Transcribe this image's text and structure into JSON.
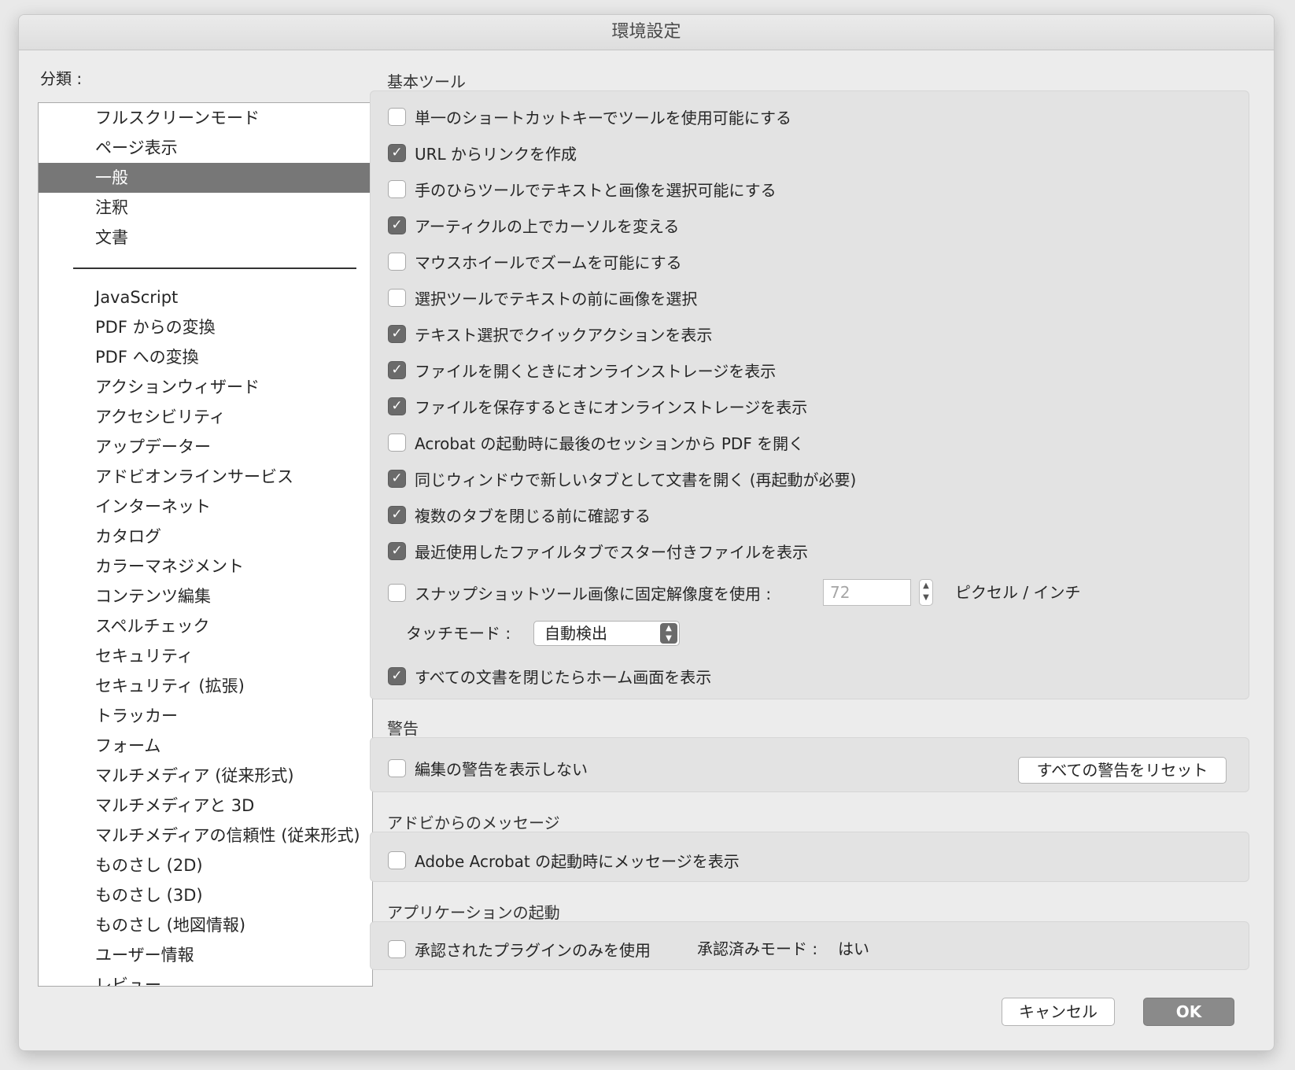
{
  "window": {
    "title": "環境設定"
  },
  "categories": {
    "label": "分類 :",
    "top_items": [
      "フルスクリーンモード",
      "ページ表示",
      "一般",
      "注釈",
      "文書"
    ],
    "selected": "一般",
    "items": [
      "JavaScript",
      "PDF からの変換",
      "PDF への変換",
      "アクションウィザード",
      "アクセシビリティ",
      "アップデーター",
      "アドビオンラインサービス",
      "インターネット",
      "カタログ",
      "カラーマネジメント",
      "コンテンツ編集",
      "スペルチェック",
      "セキュリティ",
      "セキュリティ (拡張)",
      "トラッカー",
      "フォーム",
      "マルチメディア (従来形式)",
      "マルチメディアと 3D",
      "マルチメディアの信頼性 (従来形式)",
      "ものさし (2D)",
      "ものさし (3D)",
      "ものさし (地図情報)",
      "ユーザー情報",
      "レビュー"
    ]
  },
  "basic_tools": {
    "title": "基本ツール",
    "options": [
      {
        "label": "単一のショートカットキーでツールを使用可能にする",
        "checked": false
      },
      {
        "label": "URL からリンクを作成",
        "checked": true
      },
      {
        "label": "手のひらツールでテキストと画像を選択可能にする",
        "checked": false
      },
      {
        "label": "アーティクルの上でカーソルを変える",
        "checked": true
      },
      {
        "label": "マウスホイールでズームを可能にする",
        "checked": false
      },
      {
        "label": "選択ツールでテキストの前に画像を選択",
        "checked": false
      },
      {
        "label": "テキスト選択でクイックアクションを表示",
        "checked": true
      },
      {
        "label": "ファイルを開くときにオンラインストレージを表示",
        "checked": true
      },
      {
        "label": "ファイルを保存するときにオンラインストレージを表示",
        "checked": true
      },
      {
        "label": "Acrobat の起動時に最後のセッションから PDF を開く",
        "checked": false
      },
      {
        "label": "同じウィンドウで新しいタブとして文書を開く (再起動が必要)",
        "checked": true
      },
      {
        "label": "複数のタブを閉じる前に確認する",
        "checked": true
      },
      {
        "label": "最近使用したファイルタブでスター付きファイルを表示",
        "checked": true
      }
    ],
    "snapshot": {
      "label": "スナップショットツール画像に固定解像度を使用 :",
      "checked": false,
      "value": "72",
      "unit": "ピクセル / インチ"
    },
    "touch_mode": {
      "label": "タッチモード :",
      "value": "自動検出"
    },
    "home_screen": {
      "label": "すべての文書を閉じたらホーム画面を表示",
      "checked": true
    }
  },
  "warnings": {
    "title": "警告",
    "option": {
      "label": "編集の警告を表示しない",
      "checked": false
    },
    "reset_button": "すべての警告をリセット"
  },
  "messages": {
    "title": "アドビからのメッセージ",
    "option": {
      "label": "Adobe Acrobat の起動時にメッセージを表示",
      "checked": false
    }
  },
  "startup": {
    "title": "アプリケーションの起動",
    "option": {
      "label": "承認されたプラグインのみを使用",
      "checked": false
    },
    "certified_label": "承認済みモード :",
    "certified_value": "はい"
  },
  "footer": {
    "cancel": "キャンセル",
    "ok": "OK"
  }
}
